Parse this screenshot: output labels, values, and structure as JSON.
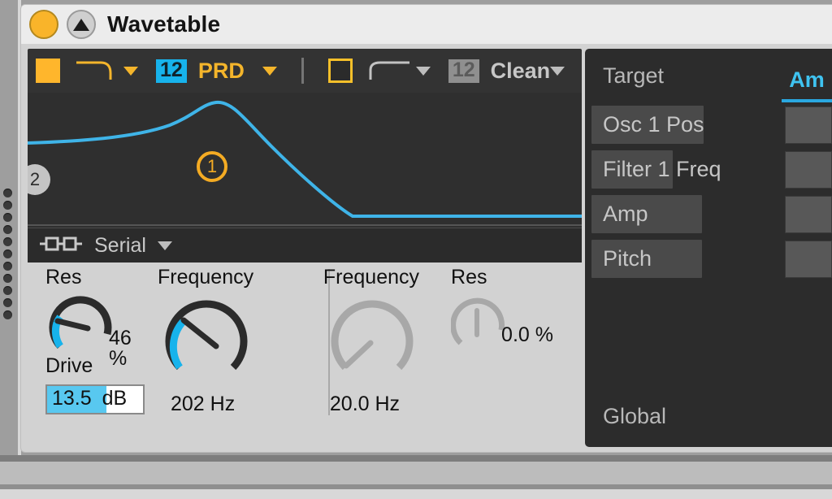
{
  "window": {
    "title": "Wavetable",
    "power_icon": "power-circle-icon",
    "fold_icon": "triangle-fold-icon"
  },
  "filter_toolbar": {
    "filter1": {
      "enabled_toggle": "filter-1-on",
      "shape_icon": "lowpass-curve-icon",
      "shape_caret": "chevron-down-icon",
      "slope": "12",
      "circuit": "PRD",
      "circuit_caret": "chevron-down-icon"
    },
    "separator": "toolbar-divider",
    "filter2": {
      "enabled_toggle": "filter-2-off",
      "shape_icon": "highpass-curve-icon",
      "shape_caret": "chevron-down-icon",
      "slope": "12",
      "circuit": "Clean",
      "circuit_caret": "chevron-down-icon"
    }
  },
  "curve_display": {
    "marker_1": "1",
    "marker_2": "2",
    "curve_color": "#3fb4e8"
  },
  "routing": {
    "icon": "serial-routing-icon",
    "label": "Serial",
    "caret": "chevron-down-icon"
  },
  "filter1_params": {
    "res": {
      "label": "Res",
      "value": "46 %"
    },
    "frequency": {
      "label": "Frequency",
      "value": "202 Hz"
    },
    "drive": {
      "label": "Drive",
      "value_number": "13.5",
      "value_unit": "dB"
    }
  },
  "filter2_params": {
    "frequency": {
      "label": "Frequency",
      "value": "20.0 Hz"
    },
    "res": {
      "label": "Res",
      "value": "0.0 %"
    }
  },
  "matrix": {
    "target_header": "Target",
    "amount_header": "Am",
    "rows": [
      {
        "target": "Osc 1 Pos",
        "amount": ""
      },
      {
        "target": "Filter 1 Freq",
        "amount": ""
      },
      {
        "target": "Amp",
        "amount": ""
      },
      {
        "target": "Pitch",
        "amount": ""
      }
    ],
    "global_label": "Global"
  },
  "colors": {
    "accent_cyan": "#17b3ec",
    "accent_amber": "#f4b52b",
    "panel_dark": "#2f2f2f",
    "panel_light": "#d2d2d2"
  }
}
